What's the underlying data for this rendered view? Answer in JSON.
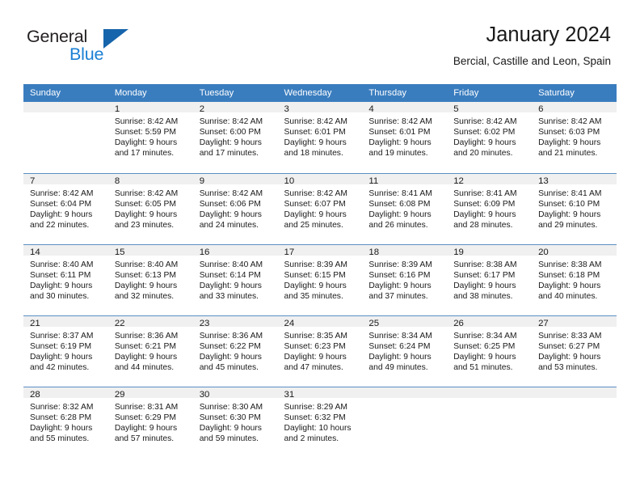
{
  "brand": {
    "name_part1": "General",
    "name_part2": "Blue",
    "logo_icon": "triangle-logo-icon"
  },
  "header": {
    "title": "January 2024",
    "subtitle": "Bercial, Castille and Leon, Spain"
  },
  "colors": {
    "header_row_bg": "#3a7dbf",
    "daynum_bg": "#f0f0f0",
    "brand_blue": "#1b7fd4",
    "logo_blue": "#1664ab",
    "grid_line": "#5a8fc4",
    "text": "#1a1a1a"
  },
  "calendar": {
    "weekday_headers": [
      "Sunday",
      "Monday",
      "Tuesday",
      "Wednesday",
      "Thursday",
      "Friday",
      "Saturday"
    ],
    "weeks": [
      [
        {
          "day": "",
          "lines": []
        },
        {
          "day": "1",
          "lines": [
            "Sunrise: 8:42 AM",
            "Sunset: 5:59 PM",
            "Daylight: 9 hours",
            "and 17 minutes."
          ]
        },
        {
          "day": "2",
          "lines": [
            "Sunrise: 8:42 AM",
            "Sunset: 6:00 PM",
            "Daylight: 9 hours",
            "and 17 minutes."
          ]
        },
        {
          "day": "3",
          "lines": [
            "Sunrise: 8:42 AM",
            "Sunset: 6:01 PM",
            "Daylight: 9 hours",
            "and 18 minutes."
          ]
        },
        {
          "day": "4",
          "lines": [
            "Sunrise: 8:42 AM",
            "Sunset: 6:01 PM",
            "Daylight: 9 hours",
            "and 19 minutes."
          ]
        },
        {
          "day": "5",
          "lines": [
            "Sunrise: 8:42 AM",
            "Sunset: 6:02 PM",
            "Daylight: 9 hours",
            "and 20 minutes."
          ]
        },
        {
          "day": "6",
          "lines": [
            "Sunrise: 8:42 AM",
            "Sunset: 6:03 PM",
            "Daylight: 9 hours",
            "and 21 minutes."
          ]
        }
      ],
      [
        {
          "day": "7",
          "lines": [
            "Sunrise: 8:42 AM",
            "Sunset: 6:04 PM",
            "Daylight: 9 hours",
            "and 22 minutes."
          ]
        },
        {
          "day": "8",
          "lines": [
            "Sunrise: 8:42 AM",
            "Sunset: 6:05 PM",
            "Daylight: 9 hours",
            "and 23 minutes."
          ]
        },
        {
          "day": "9",
          "lines": [
            "Sunrise: 8:42 AM",
            "Sunset: 6:06 PM",
            "Daylight: 9 hours",
            "and 24 minutes."
          ]
        },
        {
          "day": "10",
          "lines": [
            "Sunrise: 8:42 AM",
            "Sunset: 6:07 PM",
            "Daylight: 9 hours",
            "and 25 minutes."
          ]
        },
        {
          "day": "11",
          "lines": [
            "Sunrise: 8:41 AM",
            "Sunset: 6:08 PM",
            "Daylight: 9 hours",
            "and 26 minutes."
          ]
        },
        {
          "day": "12",
          "lines": [
            "Sunrise: 8:41 AM",
            "Sunset: 6:09 PM",
            "Daylight: 9 hours",
            "and 28 minutes."
          ]
        },
        {
          "day": "13",
          "lines": [
            "Sunrise: 8:41 AM",
            "Sunset: 6:10 PM",
            "Daylight: 9 hours",
            "and 29 minutes."
          ]
        }
      ],
      [
        {
          "day": "14",
          "lines": [
            "Sunrise: 8:40 AM",
            "Sunset: 6:11 PM",
            "Daylight: 9 hours",
            "and 30 minutes."
          ]
        },
        {
          "day": "15",
          "lines": [
            "Sunrise: 8:40 AM",
            "Sunset: 6:13 PM",
            "Daylight: 9 hours",
            "and 32 minutes."
          ]
        },
        {
          "day": "16",
          "lines": [
            "Sunrise: 8:40 AM",
            "Sunset: 6:14 PM",
            "Daylight: 9 hours",
            "and 33 minutes."
          ]
        },
        {
          "day": "17",
          "lines": [
            "Sunrise: 8:39 AM",
            "Sunset: 6:15 PM",
            "Daylight: 9 hours",
            "and 35 minutes."
          ]
        },
        {
          "day": "18",
          "lines": [
            "Sunrise: 8:39 AM",
            "Sunset: 6:16 PM",
            "Daylight: 9 hours",
            "and 37 minutes."
          ]
        },
        {
          "day": "19",
          "lines": [
            "Sunrise: 8:38 AM",
            "Sunset: 6:17 PM",
            "Daylight: 9 hours",
            "and 38 minutes."
          ]
        },
        {
          "day": "20",
          "lines": [
            "Sunrise: 8:38 AM",
            "Sunset: 6:18 PM",
            "Daylight: 9 hours",
            "and 40 minutes."
          ]
        }
      ],
      [
        {
          "day": "21",
          "lines": [
            "Sunrise: 8:37 AM",
            "Sunset: 6:19 PM",
            "Daylight: 9 hours",
            "and 42 minutes."
          ]
        },
        {
          "day": "22",
          "lines": [
            "Sunrise: 8:36 AM",
            "Sunset: 6:21 PM",
            "Daylight: 9 hours",
            "and 44 minutes."
          ]
        },
        {
          "day": "23",
          "lines": [
            "Sunrise: 8:36 AM",
            "Sunset: 6:22 PM",
            "Daylight: 9 hours",
            "and 45 minutes."
          ]
        },
        {
          "day": "24",
          "lines": [
            "Sunrise: 8:35 AM",
            "Sunset: 6:23 PM",
            "Daylight: 9 hours",
            "and 47 minutes."
          ]
        },
        {
          "day": "25",
          "lines": [
            "Sunrise: 8:34 AM",
            "Sunset: 6:24 PM",
            "Daylight: 9 hours",
            "and 49 minutes."
          ]
        },
        {
          "day": "26",
          "lines": [
            "Sunrise: 8:34 AM",
            "Sunset: 6:25 PM",
            "Daylight: 9 hours",
            "and 51 minutes."
          ]
        },
        {
          "day": "27",
          "lines": [
            "Sunrise: 8:33 AM",
            "Sunset: 6:27 PM",
            "Daylight: 9 hours",
            "and 53 minutes."
          ]
        }
      ],
      [
        {
          "day": "28",
          "lines": [
            "Sunrise: 8:32 AM",
            "Sunset: 6:28 PM",
            "Daylight: 9 hours",
            "and 55 minutes."
          ]
        },
        {
          "day": "29",
          "lines": [
            "Sunrise: 8:31 AM",
            "Sunset: 6:29 PM",
            "Daylight: 9 hours",
            "and 57 minutes."
          ]
        },
        {
          "day": "30",
          "lines": [
            "Sunrise: 8:30 AM",
            "Sunset: 6:30 PM",
            "Daylight: 9 hours",
            "and 59 minutes."
          ]
        },
        {
          "day": "31",
          "lines": [
            "Sunrise: 8:29 AM",
            "Sunset: 6:32 PM",
            "Daylight: 10 hours",
            "and 2 minutes."
          ]
        },
        {
          "day": "",
          "lines": []
        },
        {
          "day": "",
          "lines": []
        },
        {
          "day": "",
          "lines": []
        }
      ]
    ]
  }
}
